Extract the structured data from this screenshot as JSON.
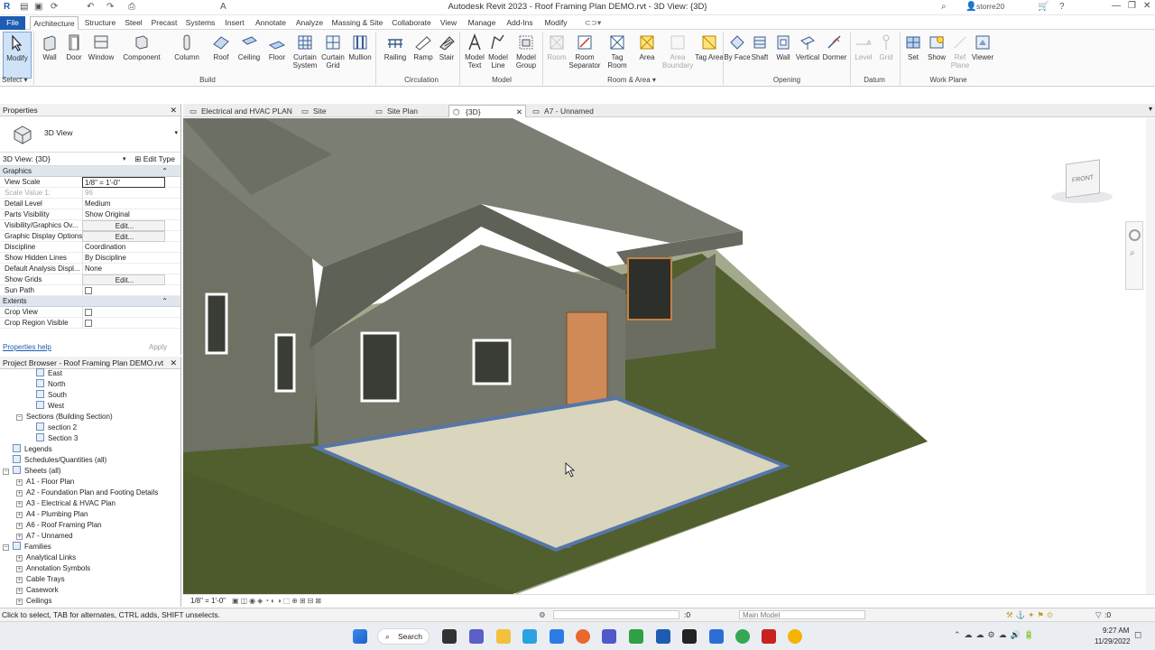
{
  "titlebar": {
    "title": "Autodesk Revit 2023 - Roof Framing Plan DEMO.rvt - 3D View: {3D}",
    "user": "storre20"
  },
  "ribbon_tabs": [
    "File",
    "Architecture",
    "Structure",
    "Steel",
    "Precast",
    "Systems",
    "Insert",
    "Annotate",
    "Analyze",
    "Massing & Site",
    "Collaborate",
    "View",
    "Manage",
    "Add-Ins",
    "Modify"
  ],
  "ribbon": {
    "buttons": [
      {
        "label": "Modify",
        "icon": "cursor-arrow-icon"
      },
      {
        "label": "Wall",
        "icon": "wall-icon"
      },
      {
        "label": "Door",
        "icon": "door-icon"
      },
      {
        "label": "Window",
        "icon": "window-icon"
      },
      {
        "label": "Component",
        "icon": "component-icon"
      },
      {
        "label": "Column",
        "icon": "column-icon"
      },
      {
        "label": "Roof",
        "icon": "roof-icon"
      },
      {
        "label": "Ceiling",
        "icon": "ceiling-icon"
      },
      {
        "label": "Floor",
        "icon": "floor-icon"
      },
      {
        "label": "Curtain System",
        "icon": "curtain-system-icon"
      },
      {
        "label": "Curtain Grid",
        "icon": "curtain-grid-icon"
      },
      {
        "label": "Mullion",
        "icon": "mullion-icon"
      },
      {
        "label": "Railing",
        "icon": "railing-icon"
      },
      {
        "label": "Ramp",
        "icon": "ramp-icon"
      },
      {
        "label": "Stair",
        "icon": "stair-icon"
      },
      {
        "label": "Model Text",
        "icon": "model-text-icon"
      },
      {
        "label": "Model Line",
        "icon": "model-line-icon"
      },
      {
        "label": "Model Group",
        "icon": "model-group-icon"
      },
      {
        "label": "Room",
        "icon": "room-icon"
      },
      {
        "label": "Room Separator",
        "icon": "room-separator-icon"
      },
      {
        "label": "Tag Room",
        "icon": "tag-room-icon"
      },
      {
        "label": "Area",
        "icon": "area-icon"
      },
      {
        "label": "Area Boundary",
        "icon": "area-boundary-icon"
      },
      {
        "label": "Tag Area",
        "icon": "tag-area-icon"
      },
      {
        "label": "By Face",
        "icon": "by-face-icon"
      },
      {
        "label": "Shaft",
        "icon": "shaft-icon"
      },
      {
        "label": "Wall",
        "icon": "wall-opening-icon"
      },
      {
        "label": "Vertical",
        "icon": "vertical-opening-icon"
      },
      {
        "label": "Dormer",
        "icon": "dormer-icon"
      },
      {
        "label": "Level",
        "icon": "level-icon"
      },
      {
        "label": "Grid",
        "icon": "grid-icon"
      },
      {
        "label": "Set",
        "icon": "set-workplane-icon"
      },
      {
        "label": "Show",
        "icon": "show-workplane-icon"
      },
      {
        "label": "Ref Plane",
        "icon": "ref-plane-icon"
      },
      {
        "label": "Viewer",
        "icon": "viewer-icon"
      }
    ],
    "groups": [
      "Select",
      "Build",
      "Circulation",
      "Model",
      "Room & Area",
      "Opening",
      "Datum",
      "Work Plane"
    ]
  },
  "doc_tabs": [
    "Electrical and HVAC PLAN",
    "Site",
    "Site Plan",
    "{3D}",
    "A7 - Unnamed"
  ],
  "properties": {
    "title": "Properties",
    "type_name": "3D View",
    "instance": "3D View: {3D}",
    "edit_type": "Edit Type",
    "sections": {
      "graphics": "Graphics",
      "extents": "Extents"
    },
    "rows": [
      {
        "k": "View Scale",
        "v": "1/8\" = 1'-0\""
      },
      {
        "k": "Scale Value    1:",
        "v": "96"
      },
      {
        "k": "Detail Level",
        "v": "Medium"
      },
      {
        "k": "Parts Visibility",
        "v": "Show Original"
      },
      {
        "k": "Visibility/Graphics Ov...",
        "v": "Edit..."
      },
      {
        "k": "Graphic Display Options",
        "v": "Edit..."
      },
      {
        "k": "Discipline",
        "v": "Coordination"
      },
      {
        "k": "Show Hidden Lines",
        "v": "By Discipline"
      },
      {
        "k": "Default Analysis Displ...",
        "v": "None"
      },
      {
        "k": "Show Grids",
        "v": "Edit..."
      },
      {
        "k": "Sun Path",
        "v": ""
      }
    ],
    "extents_rows": [
      {
        "k": "Crop View",
        "v": ""
      },
      {
        "k": "Crop Region Visible",
        "v": ""
      }
    ],
    "help": "Properties help",
    "apply": "Apply"
  },
  "browser": {
    "title": "Project Browser - Roof Framing Plan DEMO.rvt",
    "items": [
      "East",
      "North",
      "South",
      "West",
      "Sections (Building Section)",
      "section 2",
      "Section 3",
      "Legends",
      "Schedules/Quantities (all)",
      "Sheets (all)",
      "A1 - Floor Plan",
      "A2 - Foundation Plan and Footing Details",
      "A3 - Electrical & HVAC Plan",
      "A4 - Plumbing Plan",
      "A6 - Roof Framing Plan",
      "A7 - Unnamed",
      "Families",
      "Analytical Links",
      "Annotation Symbols",
      "Cable Trays",
      "Casework",
      "Ceilings"
    ]
  },
  "viewcube": {
    "face": "FRONT"
  },
  "viewbar": {
    "scale": "1/8\" = 1'-0\""
  },
  "status": {
    "hint": "Click to select, TAB for alternates, CTRL adds, SHIFT unselects.",
    "coord": ":0",
    "model": "Main Model",
    "filter": ":0"
  },
  "taskbar": {
    "search": "Search",
    "time": "9:27 AM",
    "date": "11/29/2022"
  }
}
